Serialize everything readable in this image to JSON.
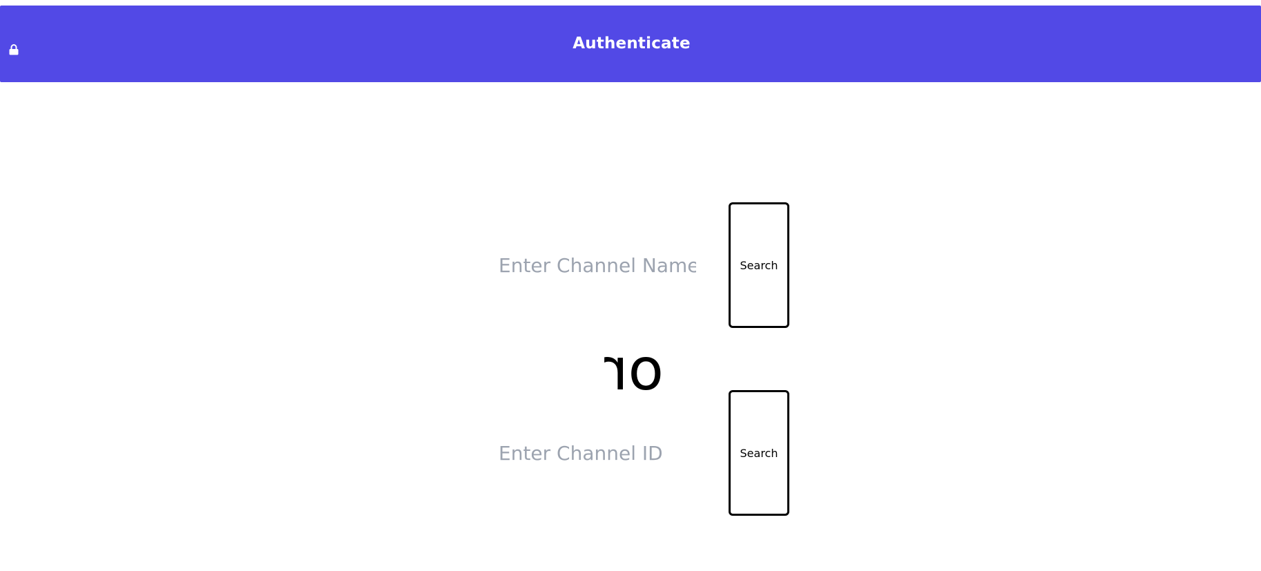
{
  "header": {
    "title": "Authenticate",
    "icon": "lock-icon",
    "color": "#5249e6"
  },
  "channel_name": {
    "placeholder": "Enter Channel Name",
    "value": "",
    "button_label": "Search"
  },
  "separator": {
    "text": "or"
  },
  "channel_id": {
    "placeholder": "Enter Channel ID",
    "value": "",
    "button_label": "Search"
  }
}
